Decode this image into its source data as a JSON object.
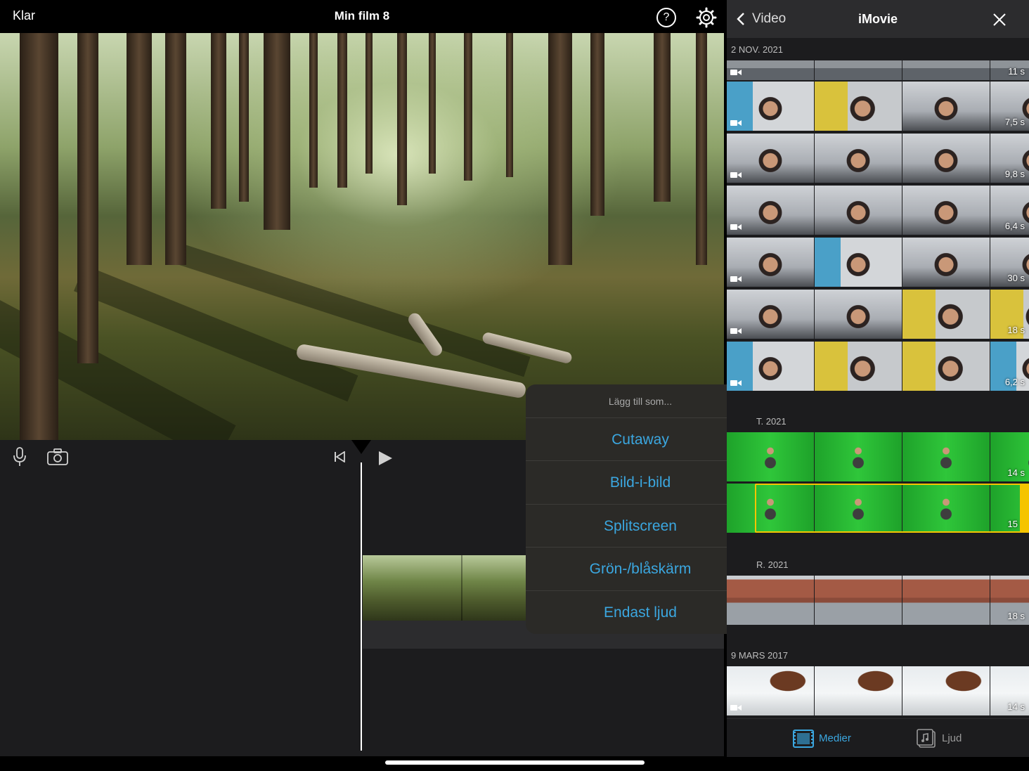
{
  "editor": {
    "done_label": "Klar",
    "title": "Min film 8"
  },
  "popover": {
    "title": "Lägg till som...",
    "items": [
      "Cutaway",
      "Bild-i-bild",
      "Splitscreen",
      "Grön-/blåskärm",
      "Endast ljud"
    ]
  },
  "browser": {
    "back_label": "Video",
    "title": "iMovie",
    "groups": [
      {
        "date": "2 NOV. 2021",
        "clips": [
          "11 s",
          "7,5 s",
          "9,8 s",
          "6,4 s",
          "30 s",
          "18 s",
          "6,2 s"
        ]
      },
      {
        "date": "T. 2021",
        "clips": [
          "14 s",
          "15"
        ]
      },
      {
        "date": "R. 2021",
        "clips": [
          "18 s"
        ]
      },
      {
        "date": "9 MARS 2017",
        "clips": [
          "14 s"
        ]
      }
    ],
    "tabs": {
      "media": "Medier",
      "audio": "Ljud"
    },
    "accent": "#3ba7e0",
    "selection_color": "#f5c400"
  }
}
